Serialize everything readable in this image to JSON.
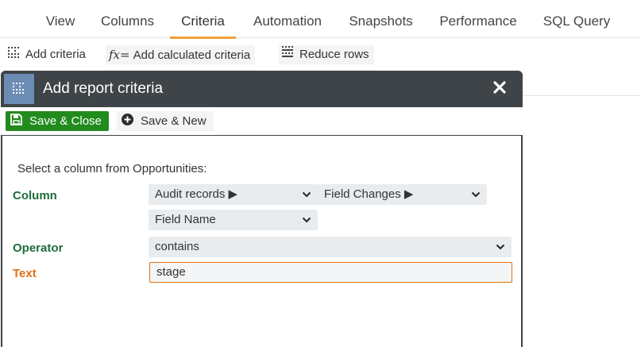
{
  "tabs": [
    {
      "label": "View"
    },
    {
      "label": "Columns"
    },
    {
      "label": "Criteria"
    },
    {
      "label": "Automation"
    },
    {
      "label": "Snapshots"
    },
    {
      "label": "Performance"
    },
    {
      "label": "SQL Query"
    }
  ],
  "active_tab": "Criteria",
  "toolbar": {
    "add_criteria": "Add criteria",
    "fx_symbol": "fx=",
    "add_calculated": "Add calculated criteria",
    "reduce_rows": "Reduce rows"
  },
  "modal": {
    "title": "Add report criteria",
    "save_close": "Save & Close",
    "save_new": "Save & New",
    "instructions": "Select a column from Opportunities:",
    "column_label": "Column",
    "column_select_1": "Audit records ▶",
    "column_select_2": "Field Changes ▶",
    "column_select_3": "Field Name",
    "operator_label": "Operator",
    "operator_value": "contains",
    "text_label": "Text",
    "text_value": "stage"
  },
  "colors": {
    "accent_tab": "#f0a03c",
    "modal_header": "#3f4448",
    "save_green": "#228b1e",
    "label_green": "#1f6e3a",
    "label_orange": "#e07014"
  },
  "icons": {
    "add_criteria": "grid-dots-icon",
    "reduce_rows": "rows-icon",
    "modal_header": "grid-dots-icon",
    "close": "close-icon",
    "save_close": "floppy-disk-icon",
    "save_new": "plus-circle-icon",
    "select": "chevron-down-icon"
  }
}
